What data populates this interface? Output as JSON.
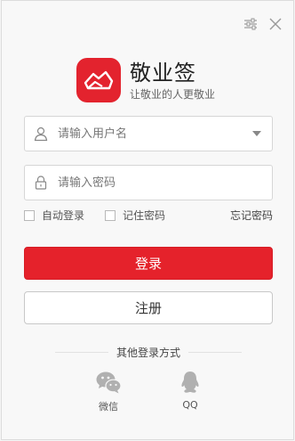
{
  "window": {
    "settings_icon": "settings-sliders-icon",
    "close_icon": "close-icon"
  },
  "brand": {
    "name": "敬业签",
    "slogan": "让敬业的人更敬业",
    "logo_color": "#e3232e"
  },
  "form": {
    "username": {
      "value": "",
      "placeholder": "请输入用户名"
    },
    "password": {
      "value": "",
      "placeholder": "请输入密码"
    },
    "auto_login_label": "自动登录",
    "remember_password_label": "记住密码",
    "forgot_password_label": "忘记密码",
    "login_button": "登录",
    "register_button": "注册"
  },
  "other_login": {
    "title": "其他登录方式",
    "wechat_label": "微信",
    "qq_label": "QQ"
  },
  "colors": {
    "accent": "#e5222b"
  }
}
